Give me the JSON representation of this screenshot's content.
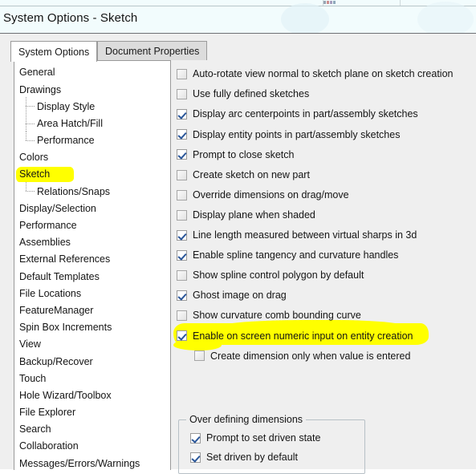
{
  "window": {
    "title": "System Options - Sketch"
  },
  "tabs": [
    {
      "label": "System Options",
      "active": true
    },
    {
      "label": "Document Properties",
      "active": false
    }
  ],
  "sidebar": {
    "items": [
      {
        "label": "General",
        "level": 0,
        "highlighted": false
      },
      {
        "label": "Drawings",
        "level": 0,
        "highlighted": false
      },
      {
        "label": "Display Style",
        "level": 1,
        "highlighted": false
      },
      {
        "label": "Area Hatch/Fill",
        "level": 1,
        "highlighted": false
      },
      {
        "label": "Performance",
        "level": 1,
        "highlighted": false,
        "last": true
      },
      {
        "label": "Colors",
        "level": 0,
        "highlighted": false
      },
      {
        "label": "Sketch",
        "level": 0,
        "highlighted": true
      },
      {
        "label": "Relations/Snaps",
        "level": 1,
        "highlighted": false,
        "last": true
      },
      {
        "label": "Display/Selection",
        "level": 0,
        "highlighted": false
      },
      {
        "label": "Performance",
        "level": 0,
        "highlighted": false
      },
      {
        "label": "Assemblies",
        "level": 0,
        "highlighted": false
      },
      {
        "label": "External References",
        "level": 0,
        "highlighted": false
      },
      {
        "label": "Default Templates",
        "level": 0,
        "highlighted": false
      },
      {
        "label": "File Locations",
        "level": 0,
        "highlighted": false
      },
      {
        "label": "FeatureManager",
        "level": 0,
        "highlighted": false
      },
      {
        "label": "Spin Box Increments",
        "level": 0,
        "highlighted": false
      },
      {
        "label": "View",
        "level": 0,
        "highlighted": false
      },
      {
        "label": "Backup/Recover",
        "level": 0,
        "highlighted": false
      },
      {
        "label": "Touch",
        "level": 0,
        "highlighted": false
      },
      {
        "label": "Hole Wizard/Toolbox",
        "level": 0,
        "highlighted": false
      },
      {
        "label": "File Explorer",
        "level": 0,
        "highlighted": false
      },
      {
        "label": "Search",
        "level": 0,
        "highlighted": false
      },
      {
        "label": "Collaboration",
        "level": 0,
        "highlighted": false
      },
      {
        "label": "Messages/Errors/Warnings",
        "level": 0,
        "highlighted": false
      }
    ]
  },
  "options": [
    {
      "label": "Auto-rotate view normal to sketch plane on sketch creation",
      "checked": false,
      "sub": false,
      "highlighted": false
    },
    {
      "label": "Use fully defined sketches",
      "checked": false,
      "sub": false,
      "highlighted": false
    },
    {
      "label": "Display arc centerpoints in part/assembly sketches",
      "checked": true,
      "sub": false,
      "highlighted": false
    },
    {
      "label": "Display entity points in part/assembly sketches",
      "checked": true,
      "sub": false,
      "highlighted": false
    },
    {
      "label": "Prompt to close sketch",
      "checked": true,
      "sub": false,
      "highlighted": false
    },
    {
      "label": "Create sketch on new part",
      "checked": false,
      "sub": false,
      "highlighted": false
    },
    {
      "label": "Override dimensions on drag/move",
      "checked": false,
      "sub": false,
      "highlighted": false
    },
    {
      "label": "Display plane when shaded",
      "checked": false,
      "sub": false,
      "highlighted": false
    },
    {
      "label": "Line length measured between virtual sharps in 3d",
      "checked": true,
      "sub": false,
      "highlighted": false
    },
    {
      "label": "Enable spline tangency and curvature handles",
      "checked": true,
      "sub": false,
      "highlighted": false
    },
    {
      "label": "Show spline control polygon by default",
      "checked": false,
      "sub": false,
      "highlighted": false
    },
    {
      "label": "Ghost image on drag",
      "checked": true,
      "sub": false,
      "highlighted": false
    },
    {
      "label": "Show curvature comb bounding curve",
      "checked": false,
      "sub": false,
      "highlighted": false
    },
    {
      "label": "Enable on screen numeric input on entity creation",
      "checked": true,
      "sub": false,
      "highlighted": true
    },
    {
      "label": "Create dimension only when value is entered",
      "checked": false,
      "sub": true,
      "highlighted": false,
      "partial_highlight": true
    }
  ],
  "group": {
    "title": "Over defining dimensions",
    "options": [
      {
        "label": "Prompt to set driven state",
        "checked": true
      },
      {
        "label": "Set driven by default",
        "checked": true
      }
    ]
  },
  "colors": {
    "highlighter": "#ffff00",
    "title_band": "#f2fcfd",
    "dialog_background": "#efefef",
    "list_background": "#ffffff",
    "check_mark": "#2a5699",
    "text": "#141414"
  }
}
